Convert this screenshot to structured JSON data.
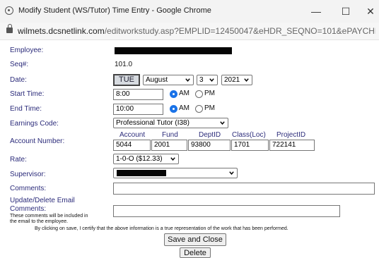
{
  "window": {
    "title": "Modify Student (WS/Tutor) Time Entry - Google Chrome",
    "minimize": "—",
    "maximize": "☐",
    "close": "✕"
  },
  "address": {
    "host": "wilmets.dcsnetlink.com",
    "path": "/editworkstudy.asp?EMPLID=12450047&eHDR_SEQNO=101&ePAYCHE..."
  },
  "form": {
    "employee_label": "Employee:",
    "seq_label": "Seq#:",
    "seq_value": "101.0",
    "date_label": "Date:",
    "date_day": "TUE",
    "date_month": "August",
    "date_daynum": "3",
    "date_year": "2021",
    "start_label": "Start Time:",
    "start_value": "8:00",
    "end_label": "End Time:",
    "end_value": "10:00",
    "am": "AM",
    "pm": "PM",
    "earnings_label": "Earnings Code:",
    "earnings_value": "Professional Tutor (I38)",
    "account_label": "Account Number:",
    "account_headers": [
      "Account",
      "Fund",
      "DeptID",
      "Class(Loc)",
      "ProjectID"
    ],
    "account_values": [
      "5044",
      "2001",
      "93800",
      "1701",
      "722141"
    ],
    "rate_label": "Rate:",
    "rate_value": "1-0-O ($12.33)",
    "supervisor_label": "Supervisor:",
    "comments_label": "Comments:",
    "update_label_1": "Update/Delete Email",
    "update_label_2": "Comments:",
    "update_note_1": "These comments will be included in",
    "update_note_2": "the email to the employee.",
    "certify": "By clicking on save, I certify that the above information is a true representation of the work that has been performed.",
    "save_close": "Save and Close",
    "delete": "Delete"
  }
}
